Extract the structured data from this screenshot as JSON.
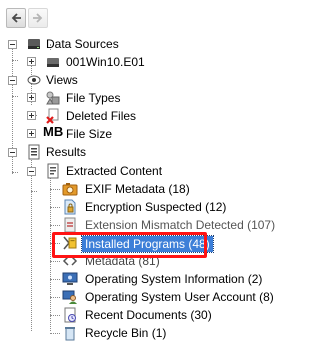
{
  "toolbar": {
    "back_icon": "arrow-left-icon",
    "forward_icon": "arrow-right-icon"
  },
  "tree": {
    "data_sources": "Data Sources",
    "image_file": "001Win10.E01",
    "views": "Views",
    "file_types": "File Types",
    "deleted_files": "Deleted Files",
    "mb_badge": "MB",
    "file_size": "File Size",
    "results": "Results",
    "extracted_content": "Extracted Content",
    "items": [
      "EXIF Metadata (18)",
      "Encryption Suspected (12)",
      "Extension Mismatch Detected (107)",
      "Installed Programs (48)",
      "Metadata (81)",
      "Operating System Information (2)",
      "Operating System User Account (8)",
      "Recent Documents (30)",
      "Recycle Bin (1)"
    ]
  },
  "colors": {
    "selection": "#3d7fd8",
    "highlight_border": "#ff1313"
  }
}
